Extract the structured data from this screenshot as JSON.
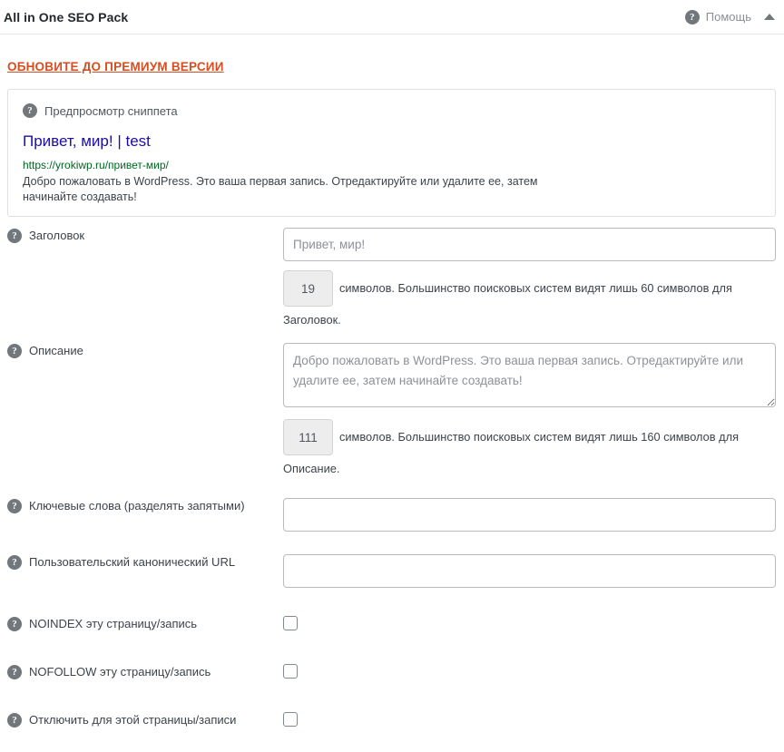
{
  "header": {
    "title": "All in One SEO Pack",
    "help_label": "Помощь",
    "help_icon": "question-mark-circle-icon",
    "toggle_icon": "triangle-up-icon"
  },
  "premium": {
    "label": "ОБНОВИТЕ ДО ПРЕМИУМ ВЕРСИИ",
    "color": "#d54e21"
  },
  "snippet": {
    "heading": "Предпросмотр сниппета",
    "title": "Привет, мир! | test",
    "title_color": "#1a0dab",
    "url": "https://yrokiwp.ru/привет-мир/",
    "url_color": "#006621",
    "description": "Добро пожаловать в WordPress. Это ваша первая запись. Отредактируйте или удалите ее, затем начинайте создавать!"
  },
  "fields": {
    "title": {
      "label": "Заголовок",
      "placeholder": "Привет, мир!",
      "value": "",
      "count": "19",
      "count_text": "символов. Большинство поисковых систем видят лишь 60 символов для",
      "count_tail": "Заголовок."
    },
    "description": {
      "label": "Описание",
      "placeholder": "Добро пожаловать в WordPress. Это ваша первая запись. Отредактируйте или удалите ее, затем начинайте создавать!",
      "value": "",
      "count": "111",
      "count_text": "символов. Большинство поисковых систем видят лишь 160 символов для",
      "count_tail": "Описание."
    },
    "keywords": {
      "label": "Ключевые слова (разделять запятыми)",
      "placeholder": "",
      "value": ""
    },
    "canonical": {
      "label": "Пользовательский канонический URL",
      "placeholder": "",
      "value": ""
    },
    "noindex": {
      "label": "NOINDEX эту страницу/запись",
      "checked": false
    },
    "nofollow": {
      "label": "NOFOLLOW эту страницу/запись",
      "checked": false
    },
    "disable": {
      "label": "Отключить для этой страницы/записи",
      "checked": false
    }
  },
  "icons": {
    "help": "?"
  }
}
